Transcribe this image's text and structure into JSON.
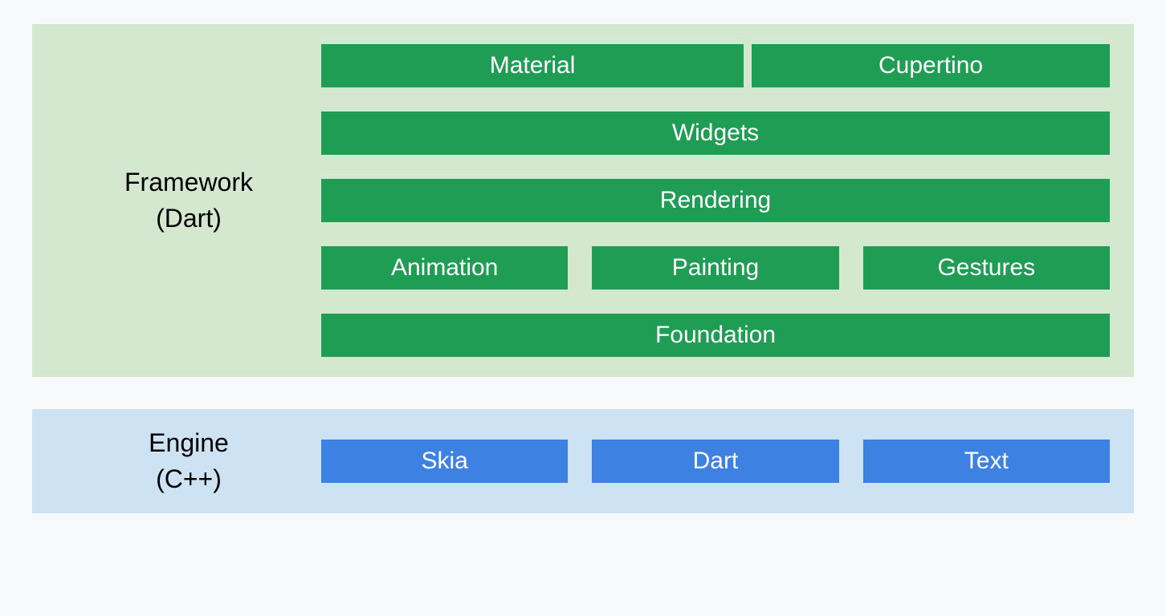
{
  "framework": {
    "label_line1": "Framework",
    "label_line2": "(Dart)",
    "rows": {
      "top": {
        "material": "Material",
        "cupertino": "Cupertino"
      },
      "widgets": "Widgets",
      "rendering": "Rendering",
      "middle": {
        "animation": "Animation",
        "painting": "Painting",
        "gestures": "Gestures"
      },
      "foundation": "Foundation"
    }
  },
  "engine": {
    "label_line1": "Engine",
    "label_line2": "(C++)",
    "items": {
      "skia": "Skia",
      "dart": "Dart",
      "text": "Text"
    }
  }
}
